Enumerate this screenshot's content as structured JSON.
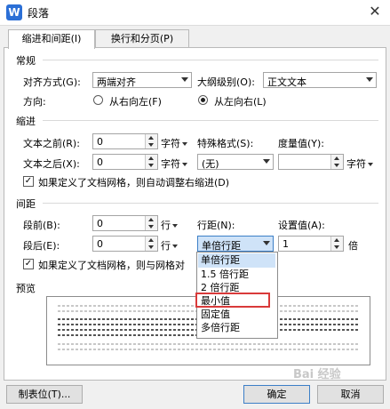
{
  "window": {
    "title": "段落",
    "app_icon_letter": "W",
    "close_glyph": "✕"
  },
  "tabs": [
    {
      "label": "缩进和间距(I)",
      "active": true
    },
    {
      "label": "换行和分页(P)",
      "active": false
    }
  ],
  "general": {
    "heading": "常规",
    "alignment_label": "对齐方式(G):",
    "alignment_value": "两端对齐",
    "outline_label": "大纲级别(O):",
    "outline_value": "正文文本",
    "direction_label": "方向:",
    "rtl_label": "从右向左(F)",
    "ltr_label": "从左向右(L)",
    "direction_selected": "ltr"
  },
  "indent": {
    "heading": "缩进",
    "before_label": "文本之前(R):",
    "before_value": "0",
    "before_unit": "字符",
    "after_label": "文本之后(X):",
    "after_value": "0",
    "after_unit": "字符",
    "special_label": "特殊格式(S):",
    "special_value": "(无)",
    "measure_label": "度量值(Y):",
    "measure_value": "",
    "measure_unit": "字符",
    "grid_check_label": "如果定义了文档网格，则自动调整右缩进(D)",
    "grid_checked": true
  },
  "spacing": {
    "heading": "间距",
    "before_label": "段前(B):",
    "before_value": "0",
    "before_unit": "行",
    "after_label": "段后(E):",
    "after_value": "0",
    "after_unit": "行",
    "line_label": "行距(N):",
    "line_value": "单倍行距",
    "setting_label": "设置值(A):",
    "setting_value": "1",
    "setting_unit": "倍",
    "grid_check_label": "如果定义了文档网格，则与网格对",
    "grid_checked": true
  },
  "line_spacing_options": [
    "单倍行距",
    "1.5 倍行距",
    "2 倍行距",
    "最小值",
    "固定值",
    "多倍行距"
  ],
  "line_spacing_highlighted": "单倍行距",
  "line_spacing_boxed": "最小值",
  "preview": {
    "heading": "预览"
  },
  "buttons": {
    "tabs": "制表位(T)...",
    "ok": "确定",
    "cancel": "取消"
  },
  "watermark": "Bai 经验"
}
